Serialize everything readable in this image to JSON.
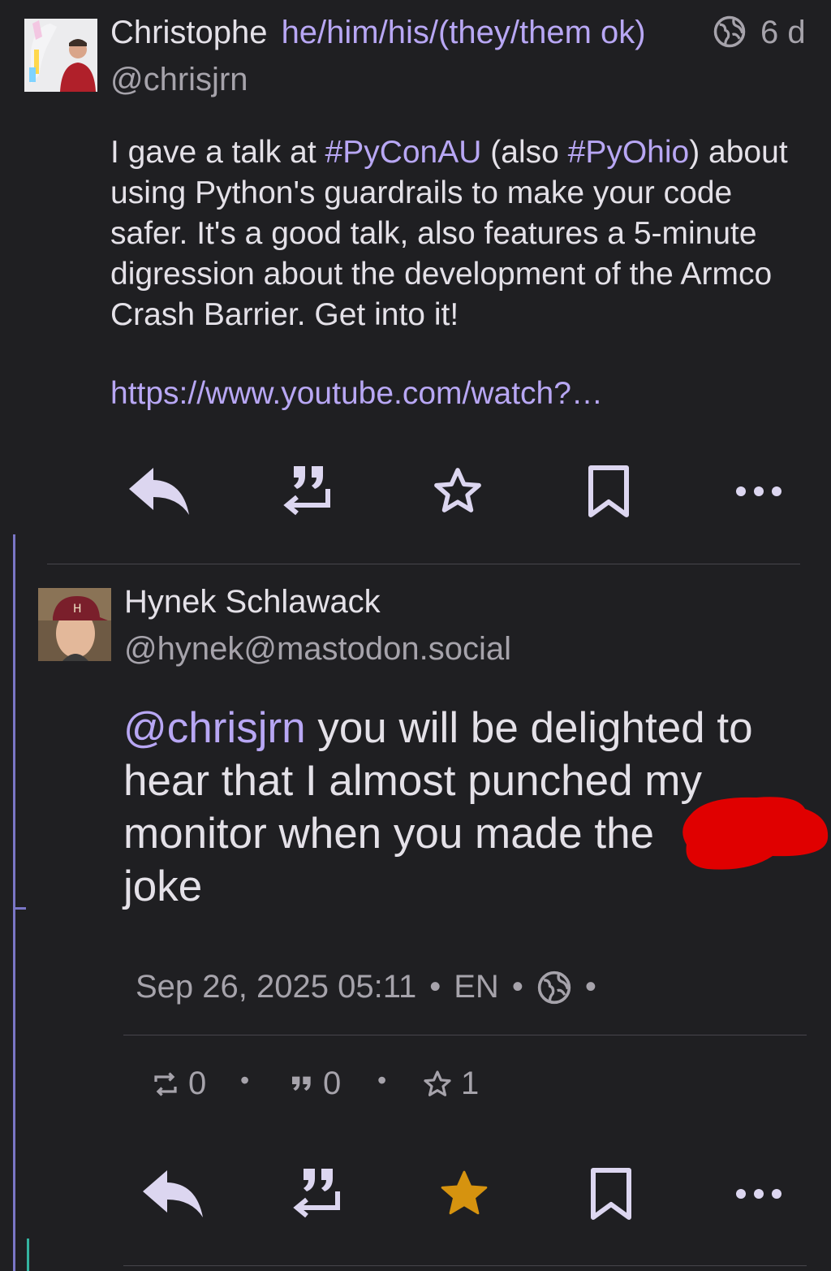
{
  "original_post": {
    "display_name": "Christophe",
    "pronouns": "he/him/his/(they/them ok)",
    "handle": "@chrisjrn",
    "age": "6 d",
    "visibility_icon": "globe-icon",
    "text_before_tag1": "I gave a talk at ",
    "tag1": "#PyConAU",
    "text_between_tags": " (also ",
    "tag2": "#PyOhio",
    "text_after_tags": ") about using Python's guardrails to make your code safer. It's a good talk, also features a 5-minute digression about the development of the Armco Crash Barrier. Get into it!",
    "link": "https://www.youtube.com/watch?…",
    "actions": [
      "reply-icon",
      "quote-icon",
      "star-outline-icon",
      "bookmark-icon",
      "more-icon"
    ]
  },
  "reply_post": {
    "display_name": "Hynek Schlawack",
    "handle": "@hynek@mastodon.social",
    "mention": "@chrisjrn",
    "text": " you will be delighted to hear that I almost punched my monitor when you made the",
    "text_end": "joke",
    "meta": {
      "date": "Sep 26, 2025 05:11",
      "language": "EN",
      "separator": "•",
      "visibility_icon": "globe-icon"
    },
    "stats": {
      "boosts": "0",
      "quotes": "0",
      "favourites": "1"
    },
    "actions": [
      "reply-icon",
      "quote-icon",
      "star-filled-icon",
      "bookmark-icon",
      "more-icon"
    ]
  },
  "colors": {
    "background": "#1f1f22",
    "text": "#e4e1e8",
    "link": "#b8a7f4",
    "muted": "#a6a3ab",
    "thread_line": "#7a76c6",
    "favourite_active": "#d6930f",
    "redaction": "#e00000"
  }
}
